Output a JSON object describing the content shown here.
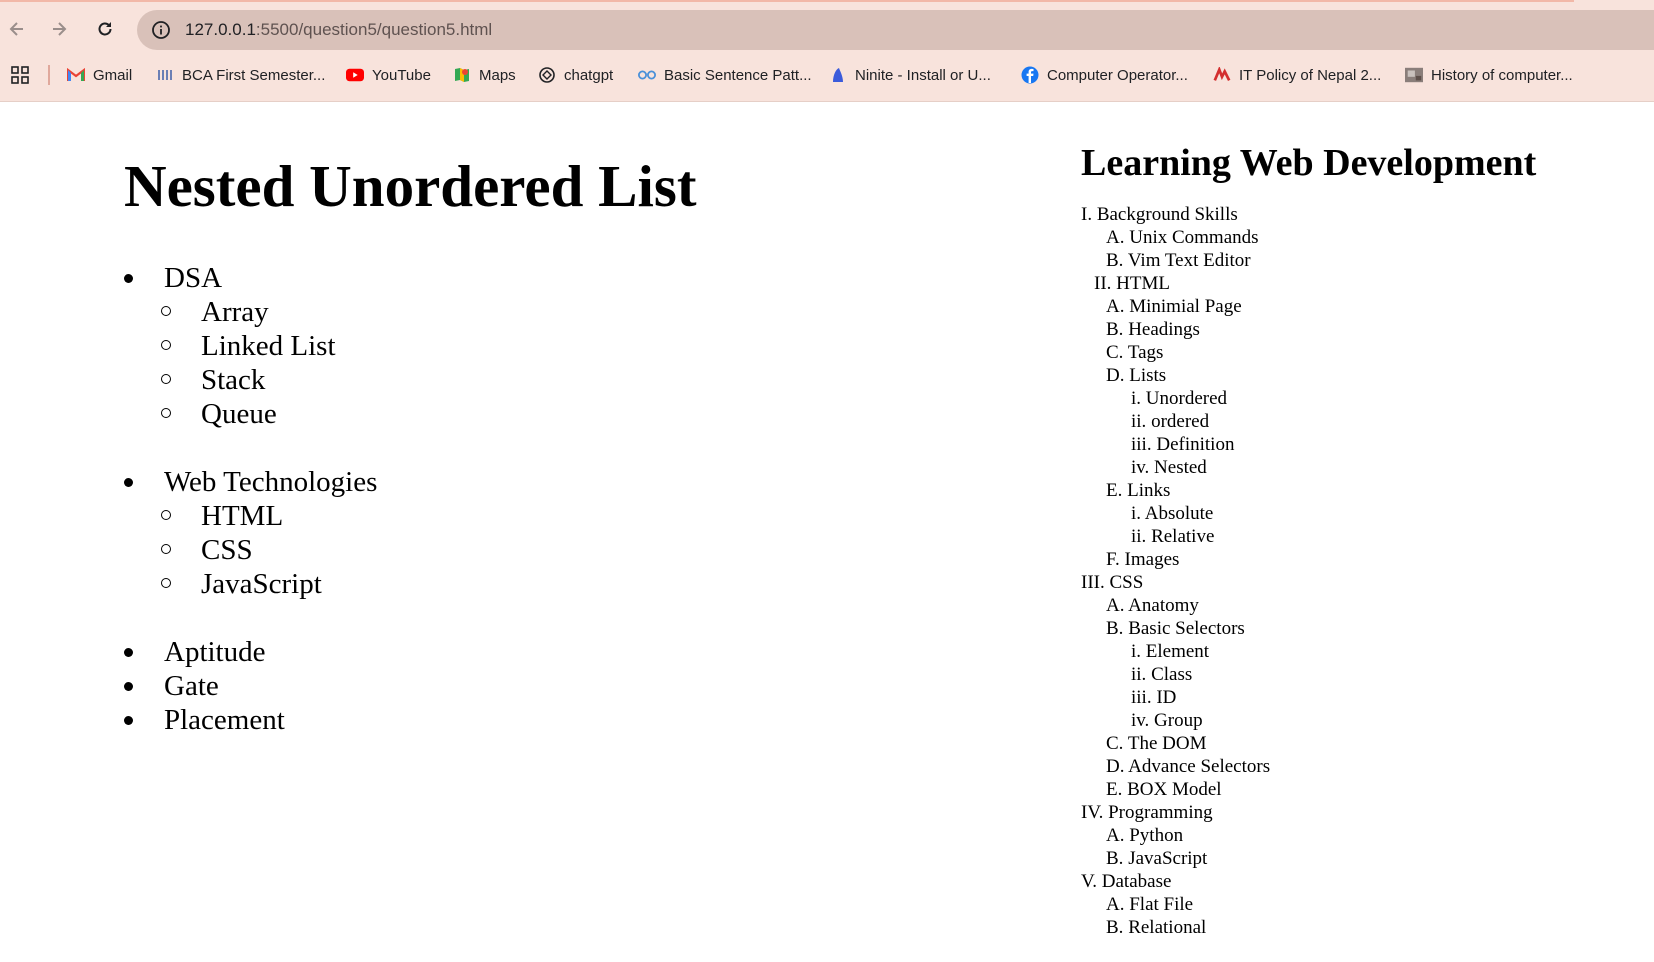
{
  "browser": {
    "url_host": "127.0.0.1",
    "url_path": ":5500/question5/question5.html",
    "bookmarks": [
      {
        "label": "Gmail",
        "icon": "gmail-icon"
      },
      {
        "label": "BCA First Semester...",
        "icon": "bca-icon"
      },
      {
        "label": "YouTube",
        "icon": "youtube-icon"
      },
      {
        "label": "Maps",
        "icon": "maps-icon"
      },
      {
        "label": "chatgpt",
        "icon": "chatgpt-icon"
      },
      {
        "label": "Basic Sentence Patt...",
        "icon": "sentence-icon"
      },
      {
        "label": "Ninite - Install or U...",
        "icon": "ninite-icon"
      },
      {
        "label": "Computer Operator...",
        "icon": "facebook-icon"
      },
      {
        "label": "IT Policy of Nepal 2...",
        "icon": "itpolicy-icon"
      },
      {
        "label": "History of computer...",
        "icon": "history-icon"
      }
    ]
  },
  "page": {
    "main_title": "Nested Unordered List",
    "nested_list": [
      {
        "label": "DSA",
        "children": [
          "Array",
          "Linked List",
          "Stack",
          "Queue"
        ]
      },
      {
        "label": "Web Technologies",
        "children": [
          "HTML",
          "CSS",
          "JavaScript"
        ]
      },
      {
        "label": "Aptitude",
        "children": []
      },
      {
        "label": "Gate",
        "children": []
      },
      {
        "label": "Placement",
        "children": []
      }
    ],
    "side_title": "Learning Web Development",
    "outline": [
      {
        "marker": "I.",
        "text": "Background Skills",
        "level": 0
      },
      {
        "marker": "A.",
        "text": "Unix Commands",
        "level": 1
      },
      {
        "marker": "B.",
        "text": "Vim Text Editor",
        "level": 1
      },
      {
        "marker": "II.",
        "text": "HTML",
        "level": 0
      },
      {
        "marker": "A.",
        "text": "Minimial Page",
        "level": 1
      },
      {
        "marker": "B.",
        "text": "Headings",
        "level": 1
      },
      {
        "marker": "C.",
        "text": "Tags",
        "level": 1
      },
      {
        "marker": "D.",
        "text": "Lists",
        "level": 1
      },
      {
        "marker": "i.",
        "text": "Unordered",
        "level": 2
      },
      {
        "marker": "ii.",
        "text": "ordered",
        "level": 2
      },
      {
        "marker": "iii.",
        "text": "Definition",
        "level": 2
      },
      {
        "marker": "iv.",
        "text": "Nested",
        "level": 2
      },
      {
        "marker": "E.",
        "text": "Links",
        "level": 1
      },
      {
        "marker": "i.",
        "text": "Absolute",
        "level": 2
      },
      {
        "marker": "ii.",
        "text": "Relative",
        "level": 2
      },
      {
        "marker": "F.",
        "text": "Images",
        "level": 1
      },
      {
        "marker": "III.",
        "text": "CSS",
        "level": 0
      },
      {
        "marker": "A.",
        "text": "Anatomy",
        "level": 1
      },
      {
        "marker": "B.",
        "text": "Basic Selectors",
        "level": 1
      },
      {
        "marker": "i.",
        "text": "Element",
        "level": 2
      },
      {
        "marker": "ii.",
        "text": "Class",
        "level": 2
      },
      {
        "marker": "iii.",
        "text": "ID",
        "level": 2
      },
      {
        "marker": "iv.",
        "text": "Group",
        "level": 2
      },
      {
        "marker": "C.",
        "text": "The DOM",
        "level": 1
      },
      {
        "marker": "D.",
        "text": "Advance Selectors",
        "level": 1
      },
      {
        "marker": "E.",
        "text": "BOX Model",
        "level": 1
      },
      {
        "marker": "IV.",
        "text": "Programming",
        "level": 0
      },
      {
        "marker": "A.",
        "text": "Python",
        "level": 1
      },
      {
        "marker": "B.",
        "text": "JavaScript",
        "level": 1
      },
      {
        "marker": "V.",
        "text": "Database",
        "level": 0
      },
      {
        "marker": "A.",
        "text": "Flat File",
        "level": 1
      },
      {
        "marker": "B.",
        "text": "Relational",
        "level": 1
      }
    ]
  }
}
